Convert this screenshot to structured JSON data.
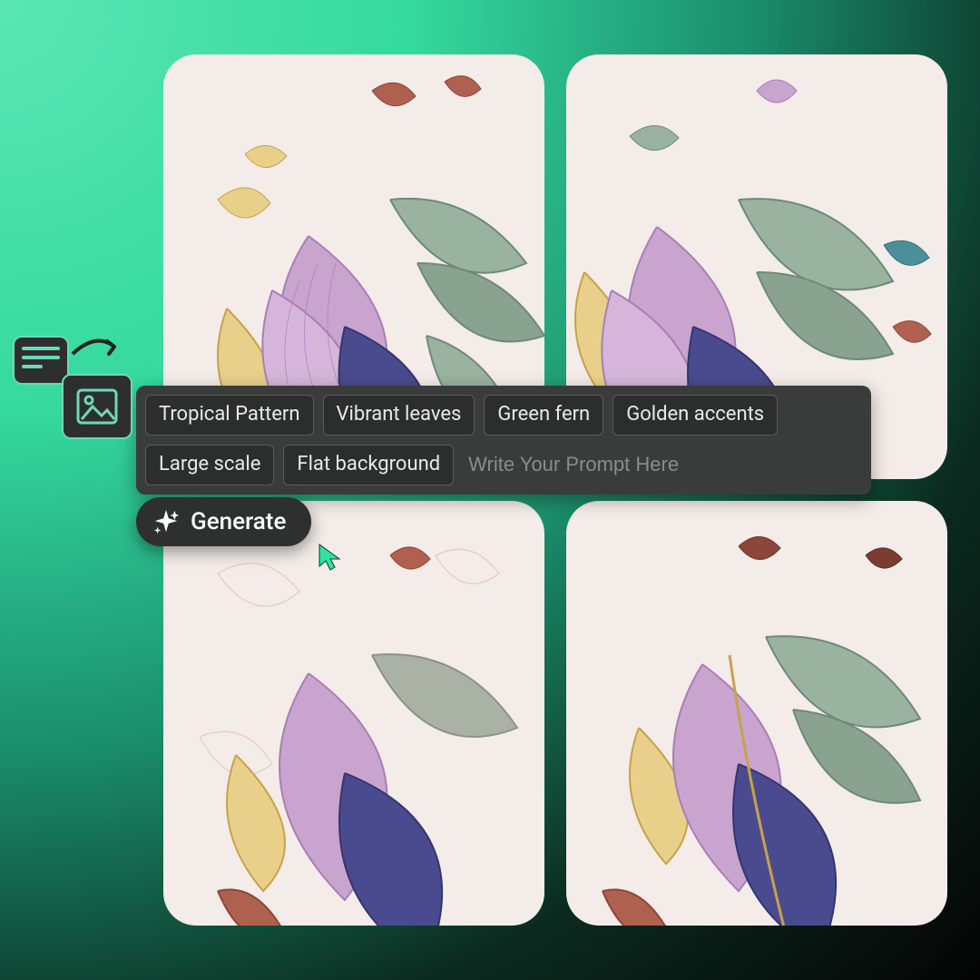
{
  "prompt": {
    "chips": [
      "Tropical Pattern",
      "Vibrant leaves",
      "Green fern",
      "Golden accents",
      "Large scale",
      "Flat background"
    ],
    "placeholder": "Write Your Prompt Here"
  },
  "generate": {
    "label": "Generate"
  },
  "results": {
    "count": 4,
    "style": "watercolor botanical leaves on cream",
    "palette": {
      "cream": "#f4ece8",
      "sage": "#9ab3a0",
      "sage_dark": "#6e8a77",
      "lilac": "#c9a4cf",
      "lilac_dark": "#a97fb6",
      "indigo": "#4a4b8f",
      "gold": "#d9b65a",
      "gold_light": "#e9d08a",
      "rust": "#b0604e",
      "rust_dark": "#8c4639",
      "teal": "#4a8f9a"
    }
  },
  "icons": {
    "text_to_image": "text-to-image-icon",
    "sparkle": "sparkle-icon",
    "cursor": "cursor-icon"
  }
}
